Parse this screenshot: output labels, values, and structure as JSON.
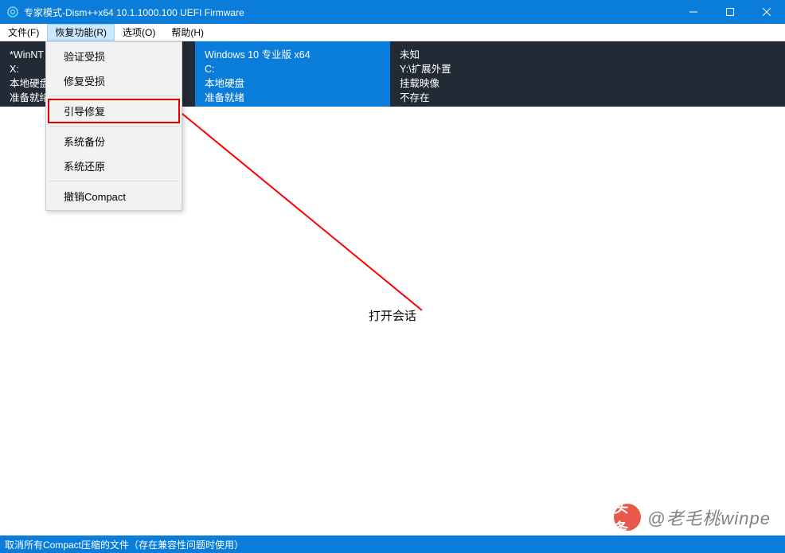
{
  "window": {
    "title": "专家模式-Dism++x64 10.1.1000.100 UEFI Firmware"
  },
  "menu": {
    "file": "文件(F)",
    "recovery": "恢复功能(R)",
    "options": "选项(O)",
    "help": "帮助(H)"
  },
  "dropdown": {
    "items": [
      "验证受损",
      "修复受损",
      "引导修复",
      "系统备份",
      "系统还原",
      "撤销Compact"
    ]
  },
  "panels": {
    "left": {
      "line1": "*WinNT",
      "line2": "X:",
      "line3": "本地硬盘",
      "line4": "准备就绪"
    },
    "mid": {
      "line1": "Windows 10 专业版 x64",
      "line2": "C:",
      "line3": "本地硬盘",
      "line4": "准备就绪"
    },
    "right": {
      "line1": "未知",
      "line2": "Y:\\扩展外置",
      "line3": "挂载映像",
      "line4": "不存在"
    }
  },
  "main": {
    "center_label": "打开会话"
  },
  "status": {
    "text": "取消所有Compact压缩的文件（存在兼容性问题时使用）"
  },
  "watermark": {
    "prefix": "头条",
    "text": "@老毛桃winpe"
  }
}
